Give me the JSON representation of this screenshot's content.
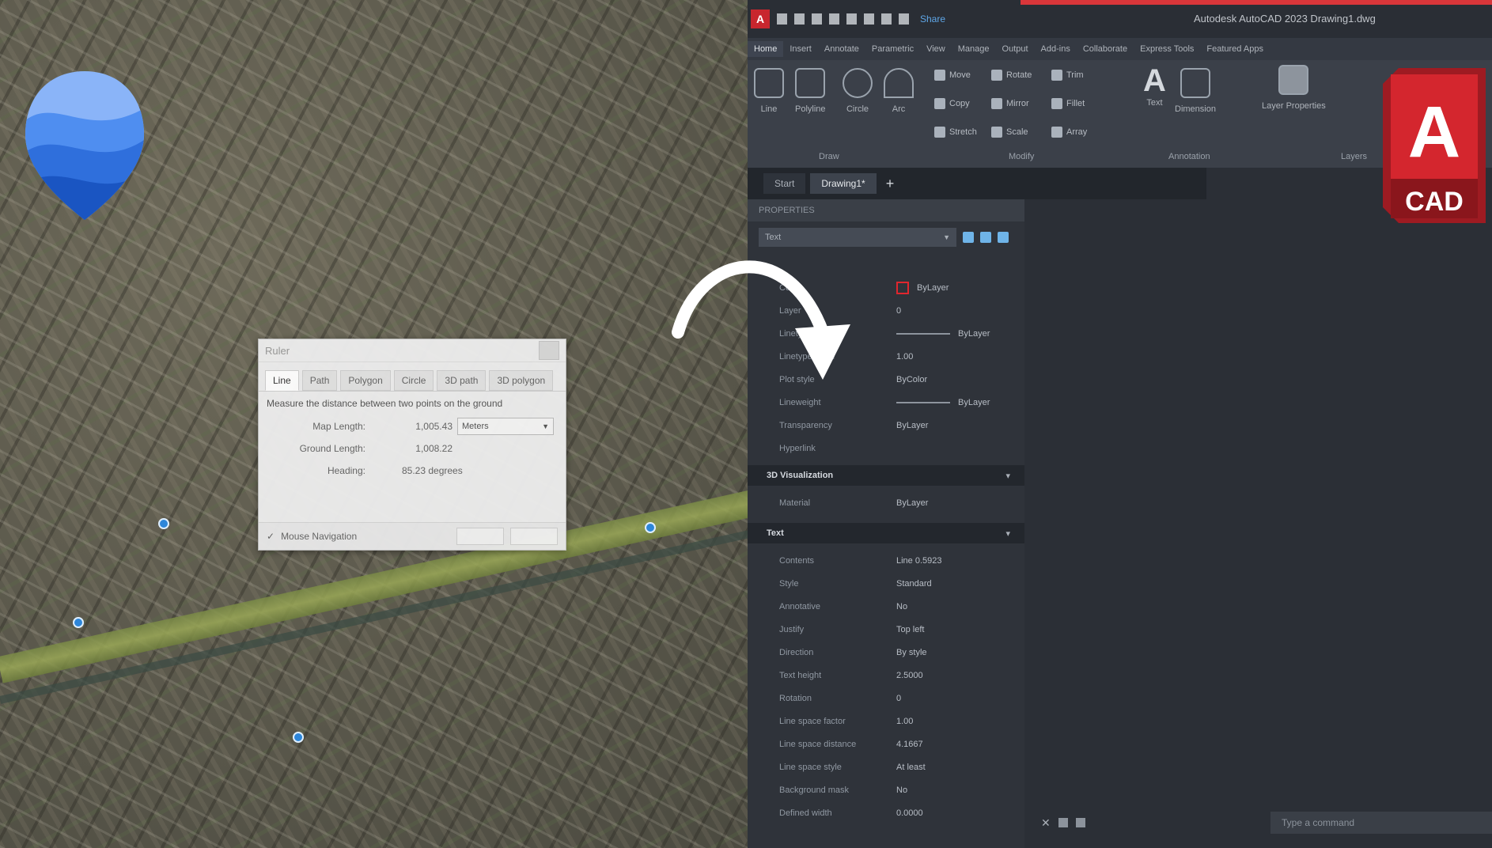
{
  "ruler": {
    "title": "Ruler",
    "tabs": [
      "Line",
      "Path",
      "Polygon",
      "Circle",
      "3D path",
      "3D polygon"
    ],
    "active_tab": "Line",
    "description": "Measure the distance between two points on the ground",
    "map_length_label": "Map Length:",
    "map_length_value": "1,005.43",
    "unit_selected": "Meters",
    "ground_length_label": "Ground Length:",
    "ground_length_value": "1,008.22",
    "heading_label": "Heading:",
    "heading_value": "85.23 degrees",
    "mouse_nav_label": "Mouse Navigation",
    "mouse_nav_checked": true
  },
  "acad": {
    "window_title": "Autodesk AutoCAD 2023   Drawing1.dwg",
    "app_button": "A",
    "share_label": "Share",
    "menus": [
      "Home",
      "Insert",
      "Annotate",
      "Parametric",
      "View",
      "Manage",
      "Output",
      "Add-ins",
      "Collaborate",
      "Express Tools",
      "Featured Apps"
    ],
    "ribbon": {
      "draw_tools": [
        "Line",
        "Polyline",
        "Circle",
        "Arc"
      ],
      "modify_tools": [
        "Move",
        "Rotate",
        "Trim",
        "Copy",
        "Mirror",
        "Fillet",
        "Stretch",
        "Scale",
        "Array"
      ],
      "annotation_tools": [
        "Text",
        "Dimension"
      ],
      "layer_tool": "Layer Properties",
      "panels": [
        "Draw",
        "Modify",
        "Annotation",
        "Layers"
      ]
    },
    "doc_tabs": [
      "Start",
      "Drawing1*"
    ],
    "properties": {
      "header": "PROPERTIES",
      "selection": "Text",
      "general": [
        {
          "key": "Color",
          "value": "ByLayer"
        },
        {
          "key": "Layer",
          "value": "0"
        },
        {
          "key": "Linetype",
          "value": "ByLayer"
        },
        {
          "key": "Linetype scale",
          "value": "1.00"
        },
        {
          "key": "Plot style",
          "value": "ByColor"
        },
        {
          "key": "Lineweight",
          "value": "ByLayer"
        },
        {
          "key": "Transparency",
          "value": "ByLayer"
        },
        {
          "key": "Hyperlink",
          "value": ""
        }
      ],
      "viz_section": "3D Visualization",
      "viz": [
        {
          "key": "Material",
          "value": "ByLayer"
        }
      ],
      "text_section": "Text",
      "text": [
        {
          "key": "Contents",
          "value": "Line   0.5923"
        },
        {
          "key": "Style",
          "value": "Standard"
        },
        {
          "key": "Annotative",
          "value": "No"
        },
        {
          "key": "Justify",
          "value": "Top left"
        },
        {
          "key": "Direction",
          "value": "By style"
        },
        {
          "key": "Text height",
          "value": "2.5000"
        },
        {
          "key": "Rotation",
          "value": "0"
        },
        {
          "key": "Line space factor",
          "value": "1.00"
        },
        {
          "key": "Line space distance",
          "value": "4.1667"
        },
        {
          "key": "Line space style",
          "value": "At least"
        },
        {
          "key": "Background mask",
          "value": "No"
        },
        {
          "key": "Defined width",
          "value": "0.0000"
        }
      ]
    },
    "command_placeholder": "Type a command"
  },
  "cad_logo": {
    "letter": "A",
    "label": "CAD",
    "color": "#d4262e"
  },
  "colors": {
    "accent_red": "#d9363a",
    "ge_blue": "#3a7ddc"
  }
}
